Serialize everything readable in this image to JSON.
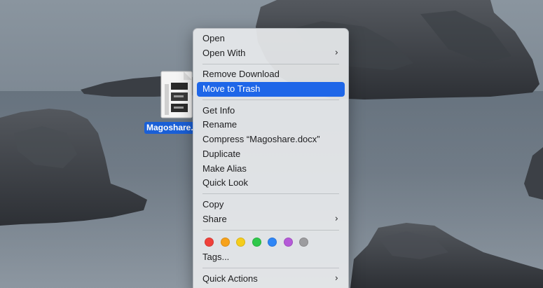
{
  "desktop": {
    "file_name": "Magoshare.docx",
    "file_label_visible": "Magoshare.",
    "file_icon": "docx-file-icon"
  },
  "context_menu": {
    "groups": [
      {
        "items": [
          {
            "label": "Open",
            "submenu": false
          },
          {
            "label": "Open With",
            "submenu": true
          }
        ]
      },
      {
        "items": [
          {
            "label": "Remove Download",
            "submenu": false
          },
          {
            "label": "Move to Trash",
            "submenu": false,
            "selected": true
          }
        ]
      },
      {
        "items": [
          {
            "label": "Get Info",
            "submenu": false
          },
          {
            "label": "Rename",
            "submenu": false
          },
          {
            "label": "Compress “Magoshare.docx”",
            "submenu": false
          },
          {
            "label": "Duplicate",
            "submenu": false
          },
          {
            "label": "Make Alias",
            "submenu": false
          },
          {
            "label": "Quick Look",
            "submenu": false
          }
        ]
      },
      {
        "items": [
          {
            "label": "Copy",
            "submenu": false
          },
          {
            "label": "Share",
            "submenu": true
          }
        ]
      },
      {
        "tags": [
          {
            "name": "red",
            "color": "#f0403a"
          },
          {
            "name": "orange",
            "color": "#f7a21b"
          },
          {
            "name": "yellow",
            "color": "#f5cd1c"
          },
          {
            "name": "green",
            "color": "#2fc84b"
          },
          {
            "name": "blue",
            "color": "#2f86f6"
          },
          {
            "name": "purple",
            "color": "#b55ad8"
          },
          {
            "name": "gray",
            "color": "#9c9c9f"
          }
        ],
        "items": [
          {
            "label": "Tags...",
            "submenu": false
          }
        ]
      },
      {
        "items": [
          {
            "label": "Quick Actions",
            "submenu": true
          }
        ]
      }
    ],
    "chevron_glyph": "›",
    "selection_color": "#1e66e8"
  }
}
